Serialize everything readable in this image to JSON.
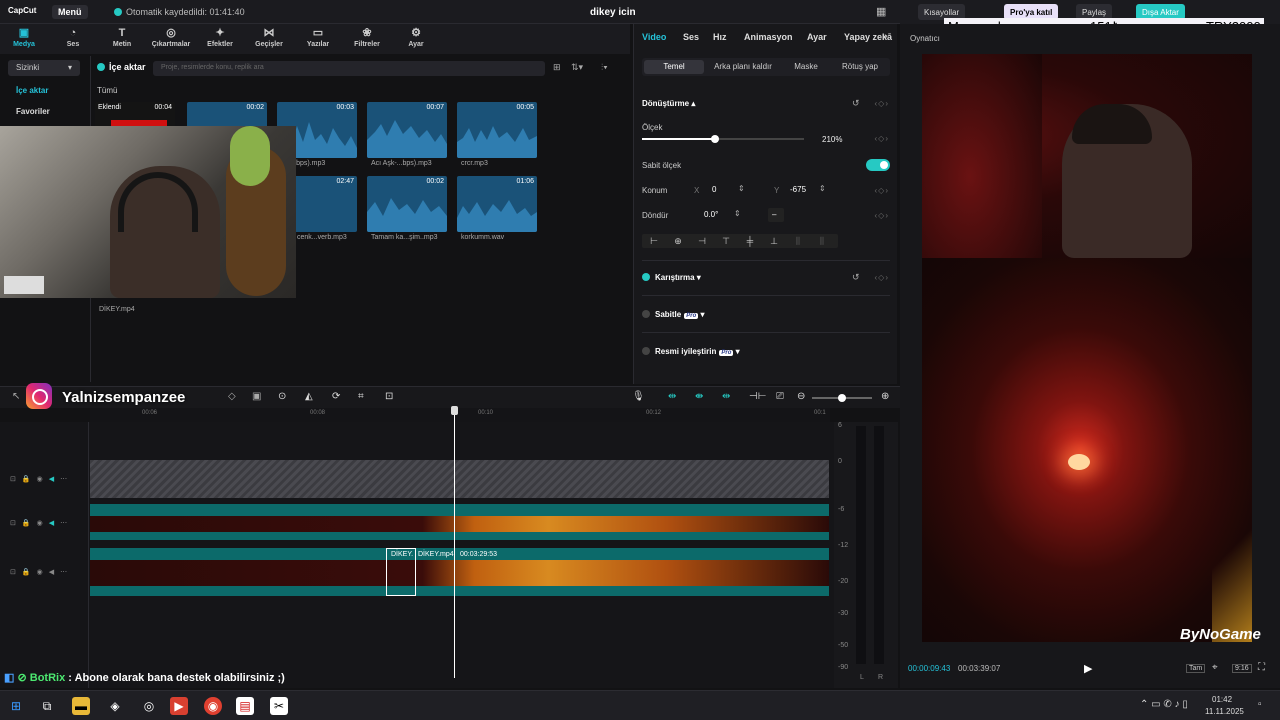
{
  "titlebar": {
    "app_logo": "CapCut",
    "menu": "Menü",
    "autosave": "Otomatik kaydedildi: 01:41:40",
    "project_title": "dikey icin",
    "layout_icon": "layout-icon"
  },
  "righttop": {
    "shortcuts": "Kısayollar",
    "pro_join": "Pro'ya katıl",
    "share": "Paylaş",
    "export": "Dışa Aktar"
  },
  "banner": {
    "left": "Mouse alacam",
    "center": "151₺",
    "right": "TRY2000"
  },
  "tool_tabs": [
    {
      "label": "Medya",
      "icon": "▣"
    },
    {
      "label": "Ses",
      "icon": "◔"
    },
    {
      "label": "Metin",
      "icon": "T"
    },
    {
      "label": "Çıkartmalar",
      "icon": "◎"
    },
    {
      "label": "Efektler",
      "icon": "✦"
    },
    {
      "label": "Geçişler",
      "icon": "⋈"
    },
    {
      "label": "Yazılar",
      "icon": "▭"
    },
    {
      "label": "Filtreler",
      "icon": "❀"
    },
    {
      "label": "Ayar",
      "icon": "⚙"
    }
  ],
  "media_nav": {
    "select": "Sizinki",
    "items": [
      "İçe aktar",
      "Favoriler"
    ]
  },
  "media": {
    "import_label": "İçe aktar",
    "search_placeholder": "Proje, resimlerde konu, replik ara",
    "all": "Tümü",
    "added_label": "Eklendi",
    "tiles": [
      {
        "dur": "00:04",
        "cap": ""
      },
      {
        "dur": "00:02",
        "cap": ""
      },
      {
        "dur": "00:03",
        "cap": "n L...kbps).mp3"
      },
      {
        "dur": "00:07",
        "cap": "Acı Aşk-...bps).mp3"
      },
      {
        "dur": "00:05",
        "cap": "crcr.mp3"
      },
      {
        "dur": "02:47",
        "cap": "cenk...verb.mp3"
      },
      {
        "dur": "00:02",
        "cap": "Tamam ka...şim..mp3"
      },
      {
        "dur": "01:06",
        "cap": "korkumm.wav"
      }
    ],
    "dikey_cap": "DİKEY.mp4"
  },
  "props": {
    "tabs": [
      "Video",
      "Ses",
      "Hız",
      "Animasyon",
      "Ayar",
      "Yapay zekā"
    ],
    "subtabs": [
      "Temel",
      "Arka planı kaldır",
      "Maske",
      "Rötuş yap"
    ],
    "transform": "Dönüştürme",
    "scale_label": "Ölçek",
    "scale_value": "210%",
    "scale_fraction": 0.45,
    "uniform_scale": "Sabit ölçek",
    "position_label": "Konum",
    "x_label": "X",
    "x_value": "0",
    "y_label": "Y",
    "y_value": "-675",
    "rotate_label": "Döndür",
    "rotate_value": "0.0°",
    "rotate_extra": "–",
    "blend": "Karıştırma",
    "stabilize": "Sabitle",
    "enhance": "Resmi iyileştirin",
    "pro": "Pro"
  },
  "player": {
    "title": "Oynatıcı",
    "current": "00:00:09:43",
    "total": "00:03:39:07",
    "full_btn": "Tam",
    "ratio_btn": "9:16"
  },
  "watermark": "ByNoGame",
  "instagram": {
    "name": "Yalnizsempanzee"
  },
  "chat": {
    "bot": "BotRix",
    "message": " : Abone olarak bana destek olabilirsiniz ;)"
  },
  "timeline": {
    "ruler": [
      "00:06",
      "00:08",
      "00:10",
      "00:12",
      "00:1"
    ],
    "clip_label": "DİKEY.",
    "clip_name": "DİKEY.mp4",
    "clip_duration": "00:03:29:53",
    "meter_labels": [
      "6",
      "0",
      "-6",
      "-12",
      "-20",
      "-30",
      "-50",
      "-90"
    ],
    "meter_lr": [
      "L",
      "R"
    ]
  },
  "taskbar": {
    "time": "01:42",
    "date": "11.11.2025"
  }
}
